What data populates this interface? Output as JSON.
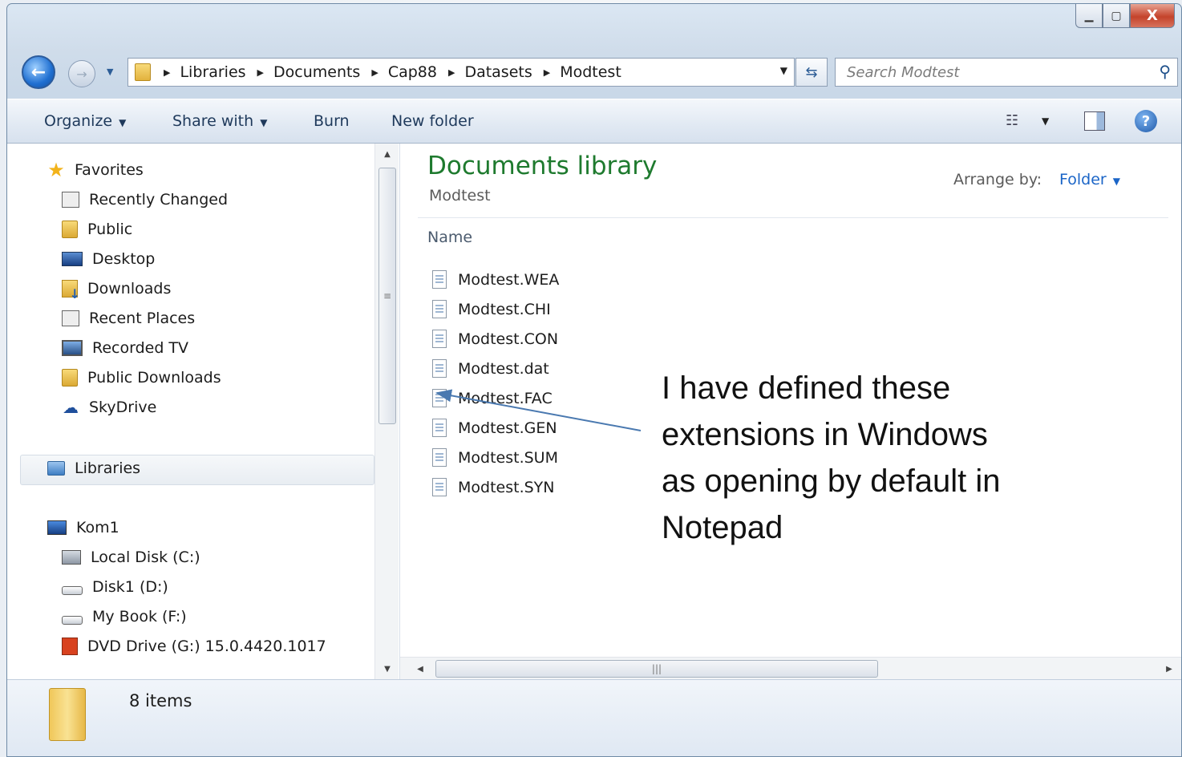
{
  "window": {
    "caption_buttons": {
      "minimize": "▁",
      "maximize": "▢",
      "close": "X"
    }
  },
  "address_bar": {
    "breadcrumbs": [
      "Libraries",
      "Documents",
      "Cap88",
      "Datasets",
      "Modtest"
    ],
    "search_placeholder": "Search Modtest"
  },
  "command_bar": {
    "organize": "Organize",
    "share_with": "Share with",
    "burn": "Burn",
    "new_folder": "New folder"
  },
  "nav": {
    "favorites_header": "Favorites",
    "favorites": [
      {
        "label": "Recently Changed",
        "icon": "recent-changed-icon"
      },
      {
        "label": "Public",
        "icon": "folder-icon"
      },
      {
        "label": "Desktop",
        "icon": "desktop-icon"
      },
      {
        "label": "Downloads",
        "icon": "downloads-icon"
      },
      {
        "label": "Recent Places",
        "icon": "recent-places-icon"
      },
      {
        "label": "Recorded TV",
        "icon": "tv-icon"
      },
      {
        "label": "Public Downloads",
        "icon": "folder-icon"
      },
      {
        "label": "SkyDrive",
        "icon": "cloud-icon"
      }
    ],
    "libraries": "Libraries",
    "computer_header": "Kom1",
    "computer": [
      {
        "label": "Local Disk (C:)",
        "icon": "local-disk-icon"
      },
      {
        "label": "Disk1 (D:)",
        "icon": "drive-icon"
      },
      {
        "label": "My Book (F:)",
        "icon": "drive-icon"
      },
      {
        "label": "DVD Drive (G:) 15.0.4420.1017",
        "icon": "dvd-icon"
      }
    ]
  },
  "content": {
    "library_title": "Documents library",
    "library_subtitle": "Modtest",
    "arrange_label": "Arrange by:",
    "arrange_value": "Folder",
    "column_name": "Name",
    "files": [
      "Modtest.WEA",
      "Modtest.CHI",
      "Modtest.CON",
      "Modtest.dat",
      "Modtest.FAC",
      "Modtest.GEN",
      "Modtest.SUM",
      "Modtest.SYN"
    ],
    "callout_lines": [
      "I have defined these",
      "extensions in Windows",
      "as opening by default in",
      "Notepad"
    ]
  },
  "details": {
    "items_count": "8 items"
  }
}
